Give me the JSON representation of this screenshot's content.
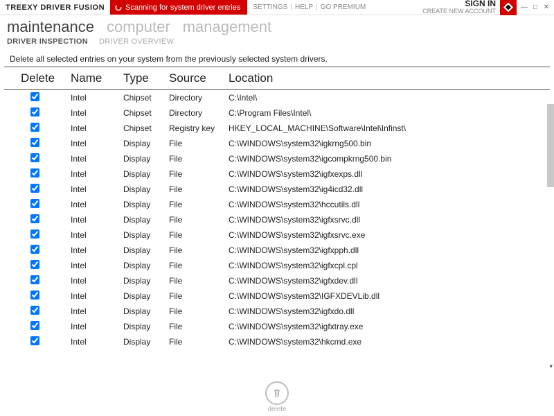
{
  "titlebar": {
    "app_title": "TREEXY DRIVER FUSION",
    "scan_text": "Scanning for system driver entries",
    "links": {
      "settings": "SETTINGS",
      "help": "HELP",
      "premium": "GO PREMIUM"
    },
    "signin": "SIGN IN",
    "create_account": "CREATE NEW ACCOUNT"
  },
  "nav": {
    "tabs": [
      {
        "label": "maintenance",
        "active": true
      },
      {
        "label": "computer",
        "active": false
      },
      {
        "label": "management",
        "active": false
      }
    ],
    "subtabs": [
      {
        "label": "DRIVER INSPECTION",
        "active": true
      },
      {
        "label": "DRIVER OVERVIEW",
        "active": false
      }
    ]
  },
  "description": "Delete all selected entries on your system from the previously selected system drivers.",
  "columns": {
    "del": "Delete",
    "name": "Name",
    "type": "Type",
    "source": "Source",
    "location": "Location"
  },
  "rows": [
    {
      "checked": true,
      "name": "Intel",
      "type": "Chipset",
      "source": "Directory",
      "location": "C:\\Intel\\"
    },
    {
      "checked": true,
      "name": "Intel",
      "type": "Chipset",
      "source": "Directory",
      "location": "C:\\Program Files\\Intel\\"
    },
    {
      "checked": true,
      "name": "Intel",
      "type": "Chipset",
      "source": "Registry key",
      "location": "HKEY_LOCAL_MACHINE\\Software\\Intel\\Infinst\\"
    },
    {
      "checked": true,
      "name": "Intel",
      "type": "Display",
      "source": "File",
      "location": "C:\\WINDOWS\\system32\\igkrng500.bin"
    },
    {
      "checked": true,
      "name": "Intel",
      "type": "Display",
      "source": "File",
      "location": "C:\\WINDOWS\\system32\\igcompkrng500.bin"
    },
    {
      "checked": true,
      "name": "Intel",
      "type": "Display",
      "source": "File",
      "location": "C:\\WINDOWS\\system32\\igfxexps.dll"
    },
    {
      "checked": true,
      "name": "Intel",
      "type": "Display",
      "source": "File",
      "location": "C:\\WINDOWS\\system32\\ig4icd32.dll"
    },
    {
      "checked": true,
      "name": "Intel",
      "type": "Display",
      "source": "File",
      "location": "C:\\WINDOWS\\system32\\hccutils.dll"
    },
    {
      "checked": true,
      "name": "Intel",
      "type": "Display",
      "source": "File",
      "location": "C:\\WINDOWS\\system32\\igfxsrvc.dll"
    },
    {
      "checked": true,
      "name": "Intel",
      "type": "Display",
      "source": "File",
      "location": "C:\\WINDOWS\\system32\\igfxsrvc.exe"
    },
    {
      "checked": true,
      "name": "Intel",
      "type": "Display",
      "source": "File",
      "location": "C:\\WINDOWS\\system32\\igfxpph.dll"
    },
    {
      "checked": true,
      "name": "Intel",
      "type": "Display",
      "source": "File",
      "location": "C:\\WINDOWS\\system32\\igfxcpl.cpl"
    },
    {
      "checked": true,
      "name": "Intel",
      "type": "Display",
      "source": "File",
      "location": "C:\\WINDOWS\\system32\\igfxdev.dll"
    },
    {
      "checked": true,
      "name": "Intel",
      "type": "Display",
      "source": "File",
      "location": "C:\\WINDOWS\\system32\\IGFXDEVLib.dll"
    },
    {
      "checked": true,
      "name": "Intel",
      "type": "Display",
      "source": "File",
      "location": "C:\\WINDOWS\\system32\\igfxdo.dll"
    },
    {
      "checked": true,
      "name": "Intel",
      "type": "Display",
      "source": "File",
      "location": "C:\\WINDOWS\\system32\\igfxtray.exe"
    },
    {
      "checked": true,
      "name": "Intel",
      "type": "Display",
      "source": "File",
      "location": "C:\\WINDOWS\\system32\\hkcmd.exe"
    }
  ],
  "footer": {
    "delete_label": "delete"
  }
}
